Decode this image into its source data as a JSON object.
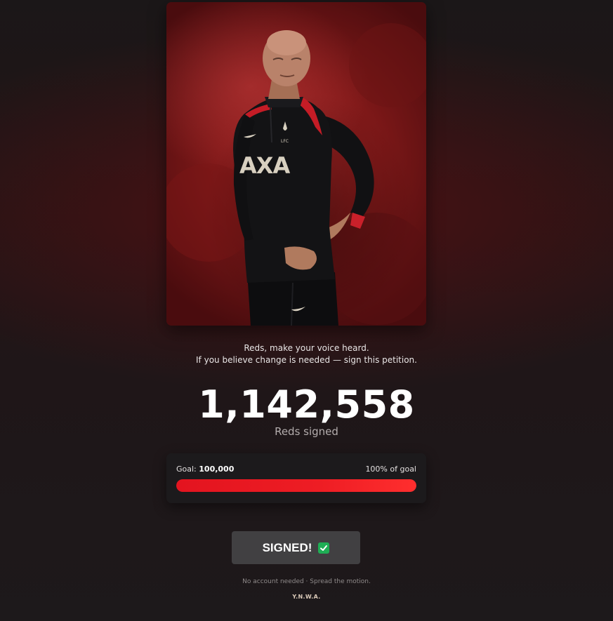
{
  "hero": {
    "shirt_sponsor": "AXA",
    "crest_initials": "LFC"
  },
  "intro": {
    "line1": "Reds, make your voice heard.",
    "line2": "If you believe change is needed — sign this petition."
  },
  "counter": {
    "value": "1,142,558",
    "label": "Reds signed"
  },
  "goal": {
    "prefix": "Goal:",
    "value": "100,000",
    "percent_text": "100% of goal",
    "progress_percent": 100
  },
  "button": {
    "label": "SIGNED!",
    "icon": "check-mark-icon"
  },
  "colors": {
    "accent": "#e3141f",
    "button_bg": "#414042",
    "check_green": "#1fae55"
  },
  "footer": {
    "note": "No account needed · Spread the motion.",
    "motto": "Y.N.W.A."
  }
}
